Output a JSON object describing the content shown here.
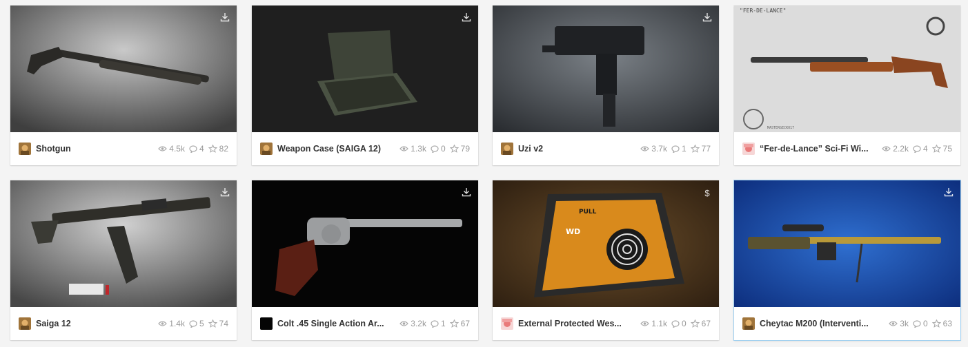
{
  "cards": [
    {
      "title": "Shotgun",
      "views": "4.5k",
      "comments": "4",
      "likes": "82",
      "corner_icon": "download-icon"
    },
    {
      "title": "Weapon Case (SAIGA 12)",
      "views": "1.3k",
      "comments": "0",
      "likes": "79",
      "corner_icon": "download-icon"
    },
    {
      "title": "Uzi v2",
      "views": "3.7k",
      "comments": "1",
      "likes": "77",
      "corner_icon": "download-icon"
    },
    {
      "title": "“Fer-de-Lance” Sci-Fi Wi...",
      "views": "2.2k",
      "comments": "4",
      "likes": "75",
      "corner_icon": "none",
      "art_text": "\"FER-DE-LANCE\"",
      "art_credit": "MASTERGECKO17"
    },
    {
      "title": "Saiga 12",
      "views": "1.4k",
      "comments": "5",
      "likes": "74",
      "corner_icon": "download-icon"
    },
    {
      "title": "Colt .45 Single Action Ar...",
      "views": "3.2k",
      "comments": "1",
      "likes": "67",
      "corner_icon": "download-icon"
    },
    {
      "title": "External Protected Wes...",
      "views": "1.1k",
      "comments": "0",
      "likes": "67",
      "corner_icon": "dollar-icon",
      "corner_text": "$",
      "art_text": "PULL",
      "art_logo": "WD"
    },
    {
      "title": "Cheytac M200 (Interventi...",
      "views": "3k",
      "comments": "0",
      "likes": "63",
      "corner_icon": "download-icon"
    }
  ]
}
